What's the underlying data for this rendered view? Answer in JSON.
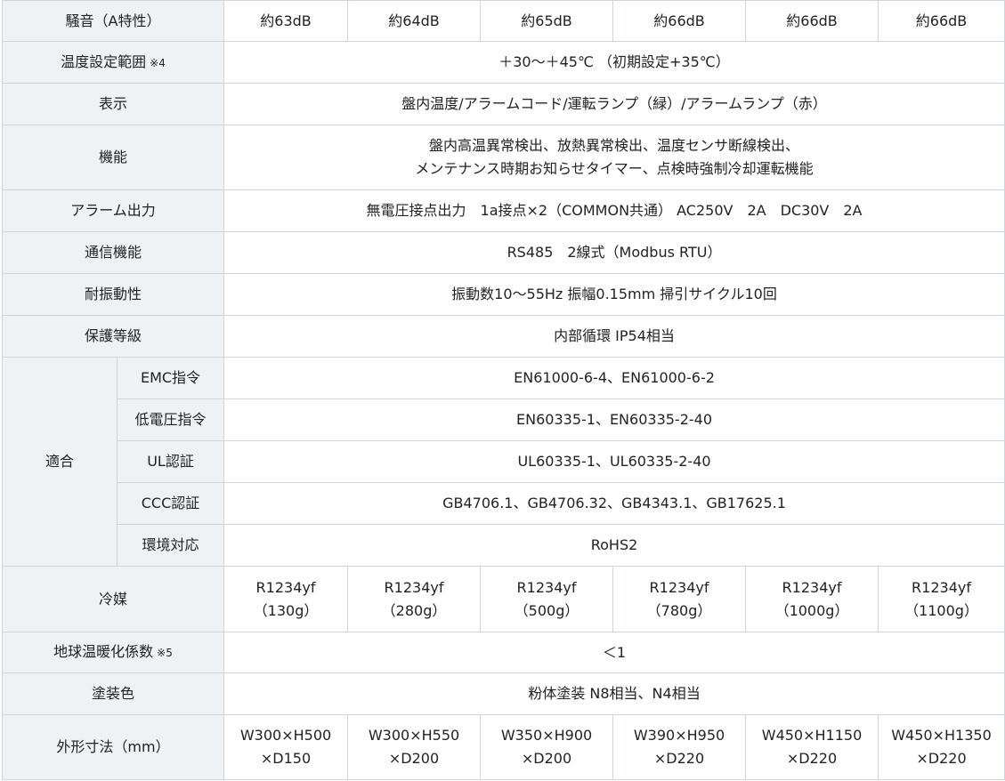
{
  "rows": {
    "noise": {
      "label": "騒音（A特性）",
      "values": [
        "約63dB",
        "約64dB",
        "約65dB",
        "約66dB",
        "約66dB",
        "約66dB"
      ]
    },
    "temp_range": {
      "label": "温度設定範囲",
      "note": "※4",
      "value": "＋30～＋45℃ （初期設定+35℃）"
    },
    "display": {
      "label": "表示",
      "value": "盤内温度/アラームコード/運転ランプ（緑）/アラームランプ（赤）"
    },
    "functions": {
      "label": "機能",
      "line1": "盤内高温異常検出、放熱異常検出、温度センサ断線検出、",
      "line2": "メンテナンス時期お知らせタイマー、点検時強制冷却運転機能"
    },
    "alarm_output": {
      "label": "アラーム出力",
      "value": "無電圧接点出力　1a接点×2（COMMON共通） AC250V　2A　DC30V　2A"
    },
    "communication": {
      "label": "通信機能",
      "value": "RS485　2線式（Modbus RTU）"
    },
    "vibration": {
      "label": "耐振動性",
      "value": "振動数10～55Hz 振幅0.15mm 掃引サイクル10回"
    },
    "protection": {
      "label": "保護等級",
      "value": "内部循環 IP54相当"
    },
    "compliance": {
      "label": "適合",
      "items": [
        {
          "label": "EMC指令",
          "value": "EN61000-6-4、EN61000-6-2"
        },
        {
          "label": "低電圧指令",
          "value": "EN60335-1、EN60335-2-40"
        },
        {
          "label": "UL認証",
          "value": "UL60335-1、UL60335-2-40"
        },
        {
          "label": "CCC認証",
          "value": "GB4706.1、GB4706.32、GB4343.1、GB17625.1"
        },
        {
          "label": "環境対応",
          "value": "RoHS2"
        }
      ]
    },
    "refrigerant": {
      "label": "冷媒",
      "values": [
        {
          "type": "R1234yf",
          "amount": "（130g）"
        },
        {
          "type": "R1234yf",
          "amount": "（280g）"
        },
        {
          "type": "R1234yf",
          "amount": "（500g）"
        },
        {
          "type": "R1234yf",
          "amount": "（780g）"
        },
        {
          "type": "R1234yf",
          "amount": "（1000g）"
        },
        {
          "type": "R1234yf",
          "amount": "（1100g）"
        }
      ]
    },
    "gwp": {
      "label": "地球温暖化係数",
      "note": "※5",
      "value": "＜1"
    },
    "paint": {
      "label": "塗装色",
      "value": "粉体塗装 N8相当、N4相当"
    },
    "dimensions": {
      "label": "外形寸法（mm）",
      "values": [
        {
          "wh": "W300×H500",
          "d": "×D150"
        },
        {
          "wh": "W300×H550",
          "d": "×D200"
        },
        {
          "wh": "W350×H900",
          "d": "×D200"
        },
        {
          "wh": "W390×H950",
          "d": "×D220"
        },
        {
          "wh": "W450×H1150",
          "d": "×D220"
        },
        {
          "wh": "W450×H1350",
          "d": "×D220"
        }
      ]
    }
  }
}
